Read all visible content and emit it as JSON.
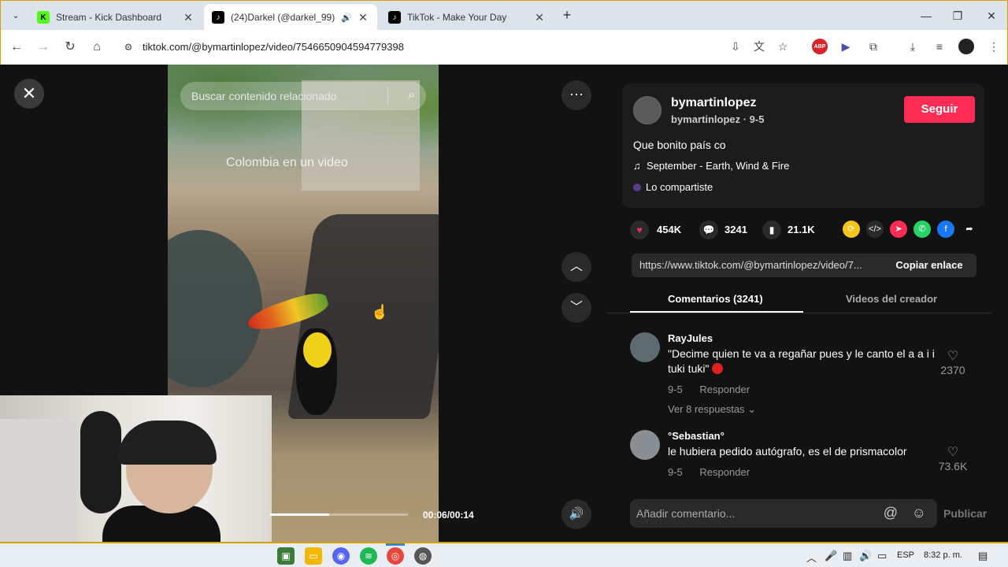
{
  "browser": {
    "tabs": [
      {
        "title": "Stream - Kick Dashboard",
        "favicon": "kick-logo-icon",
        "color": "#53fc18"
      },
      {
        "title": "(24)Darkel (@darkel_99) | Ti",
        "favicon": "tiktok-logo-icon",
        "active": true,
        "audio": true
      },
      {
        "title": "TikTok - Make Your Day",
        "favicon": "tiktok-logo-icon"
      }
    ],
    "url": "tiktok.com/@bymartinlopez/video/7546650904594779398"
  },
  "video": {
    "search_placeholder": "Buscar contenido relacionado",
    "overlay_text": "Colombia en un video",
    "time": "00:06/00:14",
    "progress": 0.43
  },
  "post": {
    "username": "bymartinlopez",
    "subtitle": "bymartinlopez · 9-5",
    "follow_label": "Seguir",
    "caption": "Que bonito país co",
    "music": "September - Earth, Wind & Fire",
    "shared_label": "Lo compartiste",
    "likes": "454K",
    "comments": "3241",
    "saves": "21.1K",
    "link": "https://www.tiktok.com/@bymartinlopez/video/7...",
    "copy_label": "Copiar enlace",
    "accent": "#fe2c55"
  },
  "tabs2": {
    "comments": "Comentarios (3241)",
    "creator": "Videos del creador"
  },
  "comments": [
    {
      "user": "RayJules",
      "text": "\"Decime quien te va a regañar pues y le canto el a a i i tuki tuki\"",
      "date": "9-5",
      "reply": "Responder",
      "likes": "2370",
      "more": "Ver 8 respuestas"
    },
    {
      "user": "°Sebastian°",
      "text": "le hubiera pedido autógrafo, es el de prismacolor",
      "date": "9-5",
      "reply": "Responder",
      "likes": "73.6K"
    }
  ],
  "compose": {
    "placeholder": "Añadir comentario...",
    "publish": "Publicar"
  },
  "taskbar": {
    "lang": "ESP",
    "clock": "8:32 p. m."
  }
}
